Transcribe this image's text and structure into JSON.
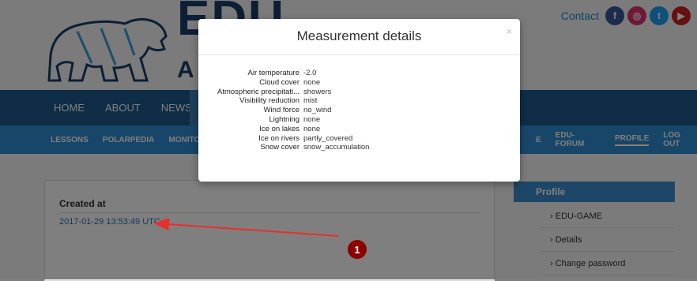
{
  "header": {
    "contact_label": "Contact",
    "logo_text_main": "EDU",
    "logo_text_sub": "A",
    "social": [
      {
        "icon": "facebook-icon",
        "glyph": "f",
        "color": "#3b5998"
      },
      {
        "icon": "instagram-icon",
        "glyph": "◎",
        "color": "#e1306c"
      },
      {
        "icon": "twitter-icon",
        "glyph": "t",
        "color": "#1da1f2"
      },
      {
        "icon": "youtube-icon",
        "glyph": "▶",
        "color": "#cd201f"
      }
    ]
  },
  "nav_primary": [
    "HOME",
    "ABOUT",
    "NEWS"
  ],
  "nav_secondary_left": [
    "LESSONS",
    "POLARPEDIA",
    "MONITORING"
  ],
  "nav_secondary_right": [
    "E",
    "EDU-FORUM",
    "PROFILE",
    "LOG OUT"
  ],
  "card": {
    "label": "Created at",
    "value": "2017-01-29 13:53:49 UTC"
  },
  "sidebar": {
    "title": "Profile",
    "links": [
      "EDU-GAME",
      "Details",
      "Change password"
    ]
  },
  "modal": {
    "title": "Measurement details",
    "close_glyph": "×",
    "rows": [
      {
        "key": "Air temperature",
        "value": "-2.0"
      },
      {
        "key": "Cloud cover",
        "value": "none"
      },
      {
        "key": "Atmospheric precipitati...",
        "value": "showers"
      },
      {
        "key": "Visibility reduction",
        "value": "mist"
      },
      {
        "key": "Wind force",
        "value": "no_wind"
      },
      {
        "key": "Lightning",
        "value": "none"
      },
      {
        "key": "Ice on lakes",
        "value": "none"
      },
      {
        "key": "Ice on rivers",
        "value": "partly_covered"
      },
      {
        "key": "Snow cover",
        "value": "snow_accumulation"
      }
    ]
  },
  "annotation": {
    "marker_number": "1",
    "arrow_color": "#e8302a"
  },
  "colors": {
    "nav_primary_bg": "#1e5a8c",
    "nav_secondary_bg": "#2e8cd0",
    "link": "#2a73b5"
  }
}
